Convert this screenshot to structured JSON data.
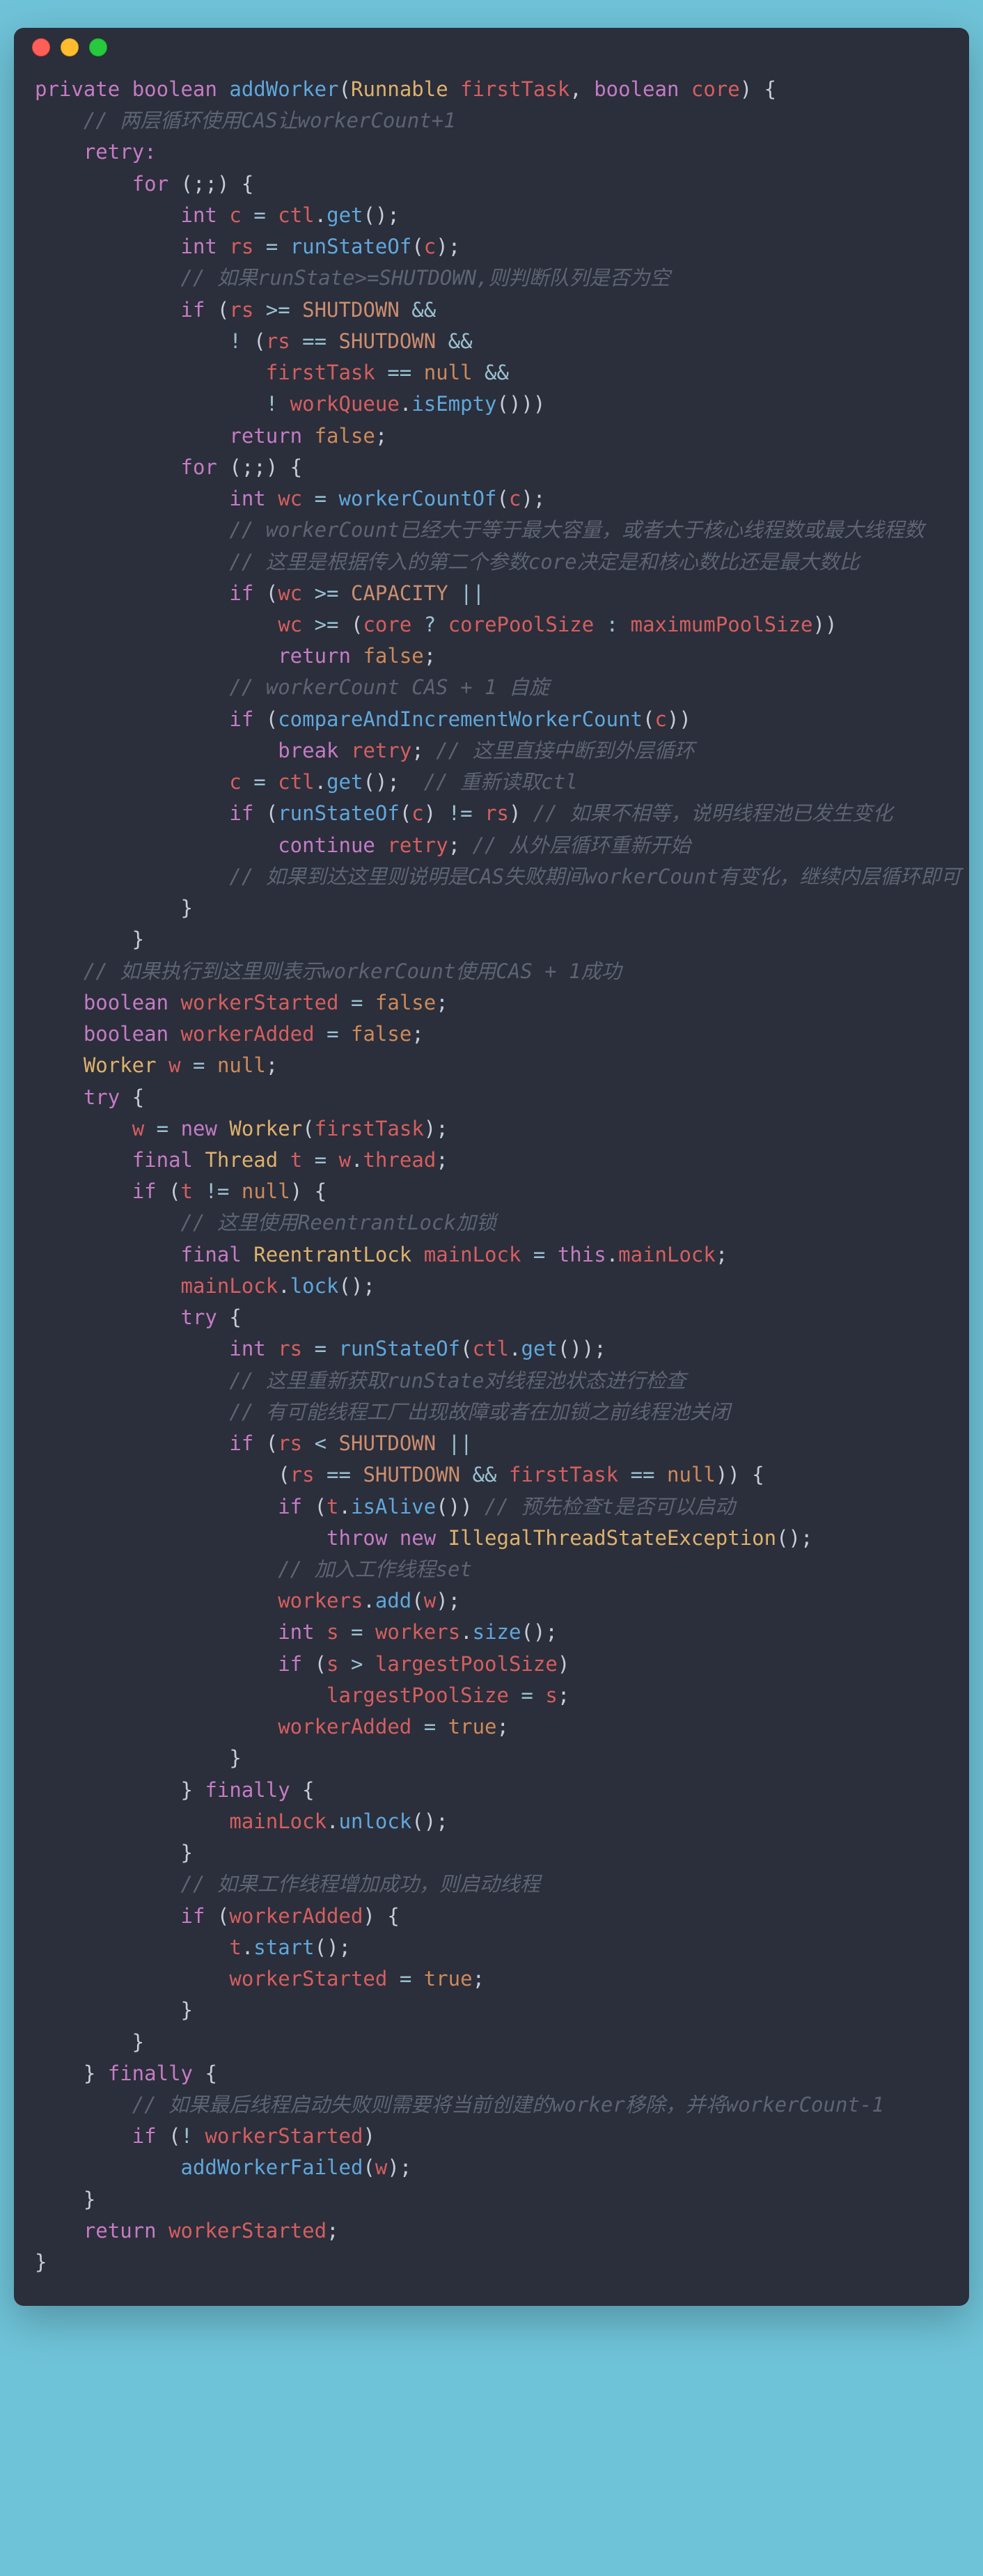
{
  "code": {
    "l01": {
      "kw1": "private",
      "kw2": "boolean",
      "fn": "addWorker",
      "p1t": "Runnable",
      "p1n": "firstTask",
      "p2t": "boolean",
      "p2n": "core"
    },
    "l02": {
      "cmt": "// 两层循环使用CAS让workerCount+1"
    },
    "l03": {
      "lbl": "retry:"
    },
    "l04": {
      "kw": "for"
    },
    "l05": {
      "t": "int",
      "v": "c",
      "fn": "get",
      "obj": "ctl"
    },
    "l06": {
      "t": "int",
      "v": "rs",
      "fn": "runStateOf",
      "arg": "c"
    },
    "l07": {
      "cmt": "// 如果runState>=SHUTDOWN,则判断队列是否为空"
    },
    "l08": {
      "kw": "if",
      "v": "rs",
      "c": "SHUTDOWN"
    },
    "l09": {
      "v": "rs",
      "c": "SHUTDOWN"
    },
    "l10": {
      "v": "firstTask",
      "b": "null"
    },
    "l11": {
      "obj": "workQueue",
      "fn": "isEmpty"
    },
    "l12": {
      "kw": "return",
      "b": "false"
    },
    "l13": {
      "kw": "for"
    },
    "l14": {
      "t": "int",
      "v": "wc",
      "fn": "workerCountOf",
      "arg": "c"
    },
    "l15": {
      "cmt": "// workerCount已经大于等于最大容量，或者大于核心线程数或最大线程数"
    },
    "l16": {
      "cmt": "// 这里是根据传入的第二个参数core决定是和核心数比还是最大数比"
    },
    "l17": {
      "kw": "if",
      "v": "wc",
      "c": "CAPACITY"
    },
    "l18": {
      "v": "wc",
      "v2": "core",
      "v3": "corePoolSize",
      "v4": "maximumPoolSize"
    },
    "l19": {
      "kw": "return",
      "b": "false"
    },
    "l20": {
      "cmt": "// workerCount CAS + 1 自旋"
    },
    "l21": {
      "kw": "if",
      "fn": "compareAndIncrementWorkerCount",
      "arg": "c"
    },
    "l22": {
      "kw": "break",
      "lbl": "retry",
      "cmt": "// 这里直接中断到外层循环"
    },
    "l23": {
      "v": "c",
      "obj": "ctl",
      "fn": "get",
      "cmt": "// 重新读取ctl"
    },
    "l24": {
      "kw": "if",
      "fn": "runStateOf",
      "arg": "c",
      "v": "rs",
      "cmt": "// 如果不相等，说明线程池已发生变化"
    },
    "l25": {
      "kw": "continue",
      "lbl": "retry",
      "cmt": "// 从外层循环重新开始"
    },
    "l26": {
      "cmt": "// 如果到达这里则说明是CAS失败期间workerCount有变化，继续内层循环即可"
    },
    "l27": {
      "cmt": "// 如果执行到这里则表示workerCount使用CAS + 1成功"
    },
    "l28": {
      "t": "boolean",
      "v": "workerStarted",
      "b": "false"
    },
    "l29": {
      "t": "boolean",
      "v": "workerAdded",
      "b": "false"
    },
    "l30": {
      "t": "Worker",
      "v": "w",
      "b": "null"
    },
    "l31": {
      "kw": "try"
    },
    "l32": {
      "v": "w",
      "kw": "new",
      "t": "Worker",
      "arg": "firstTask"
    },
    "l33": {
      "kw": "final",
      "t": "Thread",
      "v": "t",
      "v2": "w",
      "f": "thread"
    },
    "l34": {
      "kw": "if",
      "v": "t",
      "b": "null"
    },
    "l35": {
      "cmt": "// 这里使用ReentrantLock加锁"
    },
    "l36": {
      "kw": "final",
      "t": "ReentrantLock",
      "v": "mainLock",
      "this": "this",
      "f": "mainLock"
    },
    "l37": {
      "v": "mainLock",
      "fn": "lock"
    },
    "l38": {
      "kw": "try"
    },
    "l39": {
      "t": "int",
      "v": "rs",
      "fn": "runStateOf",
      "obj": "ctl",
      "fn2": "get"
    },
    "l40": {
      "cmt": "// 这里重新获取runState对线程池状态进行检查"
    },
    "l41": {
      "cmt": "// 有可能线程工厂出现故障或者在加锁之前线程池关闭"
    },
    "l42": {
      "kw": "if",
      "v": "rs",
      "c": "SHUTDOWN"
    },
    "l43": {
      "v": "rs",
      "c": "SHUTDOWN",
      "v2": "firstTask",
      "b": "null"
    },
    "l44": {
      "kw": "if",
      "v": "t",
      "fn": "isAlive",
      "cmt": "// 预先检查t是否可以启动"
    },
    "l45": {
      "kw": "throw",
      "kw2": "new",
      "t": "IllegalThreadStateException"
    },
    "l46": {
      "cmt": "// 加入工作线程set"
    },
    "l47": {
      "v": "workers",
      "fn": "add",
      "arg": "w"
    },
    "l48": {
      "t": "int",
      "v": "s",
      "v2": "workers",
      "fn": "size"
    },
    "l49": {
      "kw": "if",
      "v": "s",
      "v2": "largestPoolSize"
    },
    "l50": {
      "v": "largestPoolSize",
      "v2": "s"
    },
    "l51": {
      "v": "workerAdded",
      "b": "true"
    },
    "l52": {
      "kw": "finally"
    },
    "l53": {
      "v": "mainLock",
      "fn": "unlock"
    },
    "l54": {
      "cmt": "// 如果工作线程增加成功，则启动线程"
    },
    "l55": {
      "kw": "if",
      "v": "workerAdded"
    },
    "l56": {
      "v": "t",
      "fn": "start"
    },
    "l57": {
      "v": "workerStarted",
      "b": "true"
    },
    "l58": {
      "kw": "finally"
    },
    "l59": {
      "cmt": "// 如果最后线程启动失败则需要将当前创建的worker移除，并将workerCount-1"
    },
    "l60": {
      "kw": "if",
      "v": "workerStarted"
    },
    "l61": {
      "fn": "addWorkerFailed",
      "arg": "w"
    },
    "l62": {
      "kw": "return",
      "v": "workerStarted"
    }
  }
}
